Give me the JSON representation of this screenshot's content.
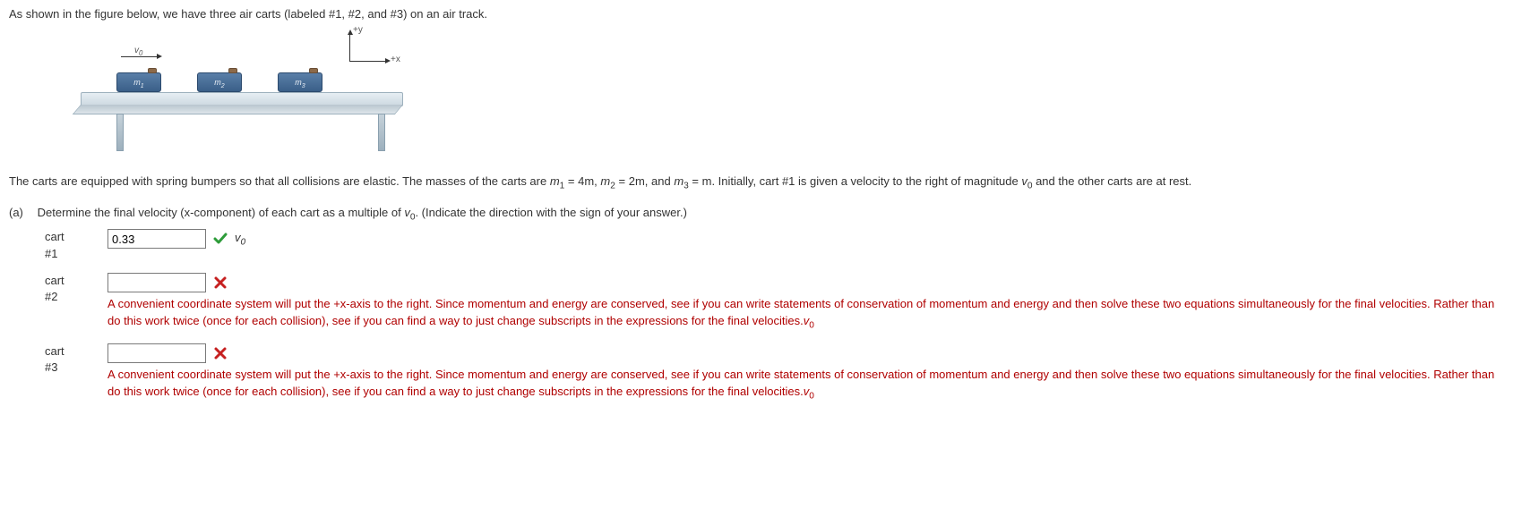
{
  "intro_line": "As shown in the figure below, we have three air carts (labeled #1, #2, and #3) on an air track.",
  "figure": {
    "v0_label": "v",
    "v0_sub": "0",
    "axis_y": "+y",
    "axis_x": "+x",
    "cart_labels": {
      "c1": "m",
      "c1s": "1",
      "c2": "m",
      "c2s": "2",
      "c3": "m",
      "c3s": "3"
    }
  },
  "desc_prefix": "The carts are equipped with spring bumpers so that all collisions are elastic. The masses of the carts are ",
  "m1": "m",
  "m1s": "1",
  "m1eq": " = 4m, ",
  "m2": "m",
  "m2s": "2",
  "m2eq": " = 2m, and ",
  "m3": "m",
  "m3s": "3",
  "m3eq": " = m. ",
  "desc_mid": "Initially, cart #1 is given a velocity to the right of magnitude ",
  "v0": "v",
  "v0s": "0",
  "desc_suffix": " and the other carts are at rest.",
  "part_a": {
    "label": "(a)",
    "prompt_pre": "Determine the final velocity (x-component) of each cart as a multiple of ",
    "prompt_v": "v",
    "prompt_vs": "0",
    "prompt_post": ". (Indicate the direction with the sign of your answer.)"
  },
  "answers": {
    "cart1": {
      "label_l1": "cart",
      "label_l2": "#1",
      "value": "0.33",
      "status": "correct",
      "unit_v": "v",
      "unit_s": "0"
    },
    "cart2": {
      "label_l1": "cart",
      "label_l2": "#2",
      "value": "",
      "status": "incorrect",
      "feedback_pre": "A convenient coordinate system will put the +x-axis to the right. Since momentum and energy are conserved, see if you can write statements of conservation of momentum and energy and then solve these two equations simultaneously for the final velocities. Rather than do this work twice (once for each collision), see if you can find a way to just change subscripts in the expressions for the final velocities.",
      "feedback_v": "v",
      "feedback_vs": "0"
    },
    "cart3": {
      "label_l1": "cart",
      "label_l2": "#3",
      "value": "",
      "status": "incorrect",
      "feedback_pre": "A convenient coordinate system will put the +x-axis to the right. Since momentum and energy are conserved, see if you can write statements of conservation of momentum and energy and then solve these two equations simultaneously for the final velocities. Rather than do this work twice (once for each collision), see if you can find a way to just change subscripts in the expressions for the final velocities.",
      "feedback_v": "v",
      "feedback_vs": "0"
    }
  }
}
